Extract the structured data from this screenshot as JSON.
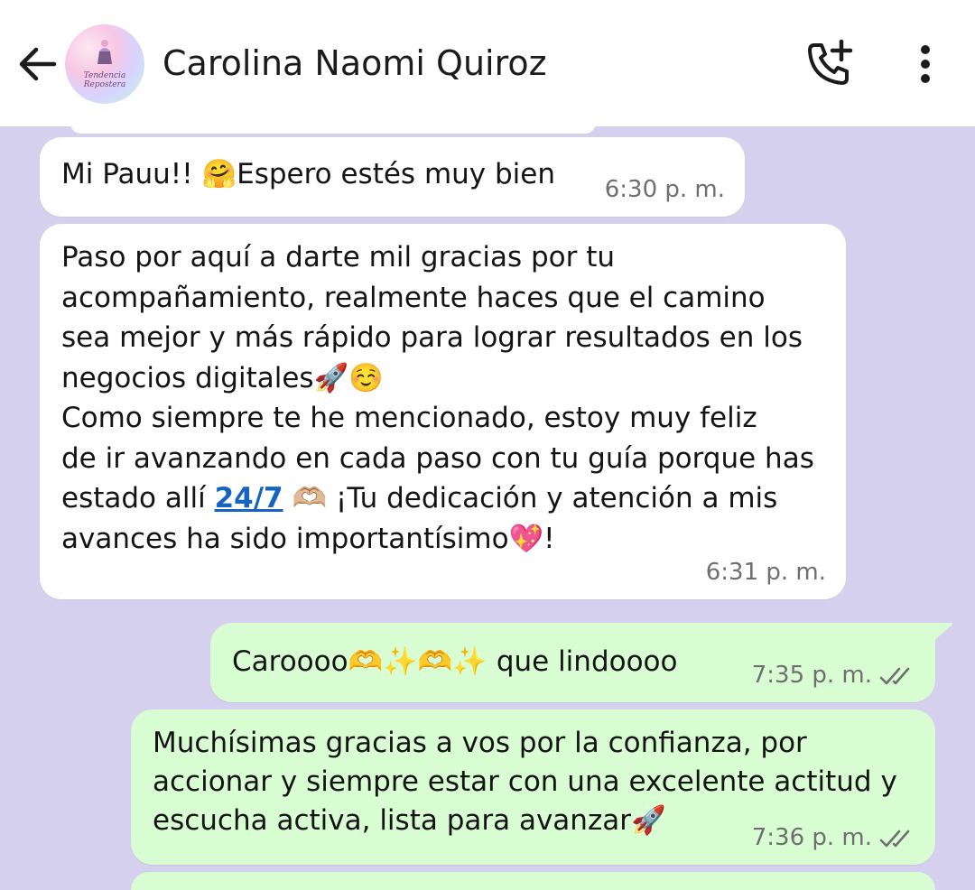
{
  "header": {
    "contact_name": "Carolina Naomi Quiroz",
    "avatar_caption": "Tendencia Repostera",
    "icons": {
      "back": "arrow-left-icon",
      "call": "phone-add-icon",
      "menu": "more-vertical-icon"
    }
  },
  "messages": [
    {
      "direction": "incoming",
      "text": "Mi Pauu!! 🤗Espero estés muy bien",
      "time": "6:30 p. m."
    },
    {
      "direction": "incoming",
      "text_part1": "Paso por aquí a darte mil gracias por tu\nacompañamiento, realmente haces que el camino\nsea mejor y más rápido para lograr resultados en los\nnegocios digitales🚀☺️\nComo siempre te he mencionado, estoy muy feliz\nde ir avanzando en cada paso con tu guía porque has\nestado allí ",
      "link_text": "24/7",
      "text_part2": " 🫶🏼 ¡Tu dedicación y atención a mis\navances ha sido importantísimo💖!",
      "time": "6:31 p. m."
    },
    {
      "direction": "outgoing",
      "text": "Caroooo🫶✨🫶✨ que lindoooo",
      "time": "7:35 p. m.",
      "status": "double-check-icon"
    },
    {
      "direction": "outgoing",
      "text": "Muchísimas gracias a vos por la confianza, por\naccionar y siempre estar con una excelente actitud y\nescucha activa, lista para avanzar🚀",
      "time": "7:36 p. m.",
      "status": "double-check-icon"
    }
  ],
  "colors": {
    "chat_background": "#d6d0ef",
    "incoming_bubble": "#ffffff",
    "outgoing_bubble": "#d9fdd3",
    "link": "#1565c0"
  }
}
